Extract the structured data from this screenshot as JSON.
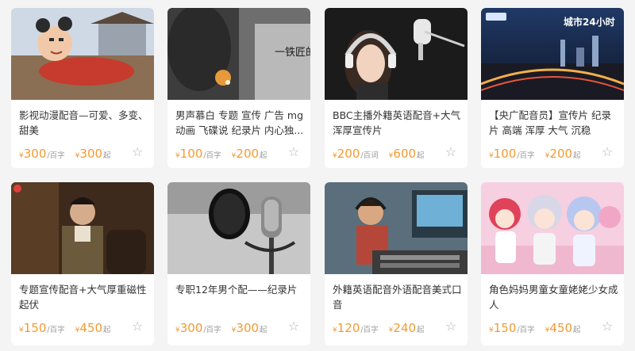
{
  "currency": "¥",
  "cards": [
    {
      "title": "影视动漫配音—可爱、多变、甜美",
      "price": "300",
      "unit": "/百字",
      "price2": "300",
      "suffix": "起",
      "thumb_label": ""
    },
    {
      "title": "男声慕白 专题 宣传 广告 mg动画 飞碟说 纪录片 内心独...",
      "price": "100",
      "unit": "/百字",
      "price2": "200",
      "suffix": "起",
      "thumb_label": "一铁匠的初"
    },
    {
      "title": "BBC主播外籍英语配音+大气浑厚宣传片",
      "price": "200",
      "unit": "/百词",
      "price2": "600",
      "suffix": "起",
      "thumb_label": ""
    },
    {
      "title": "【央广配音员】宣传片 纪录片 高端 浑厚 大气 沉稳",
      "price": "100",
      "unit": "/百字",
      "price2": "200",
      "suffix": "起",
      "thumb_label": "城市24小时"
    },
    {
      "title": "专题宣传配音+大气厚重磁性起伏",
      "price": "150",
      "unit": "/百字",
      "price2": "450",
      "suffix": "起",
      "thumb_label": ""
    },
    {
      "title": "专职12年男个配——纪录片",
      "price": "300",
      "unit": "/百字",
      "price2": "300",
      "suffix": "起",
      "thumb_label": ""
    },
    {
      "title": "外籍英语配音外语配音美式口音",
      "price": "120",
      "unit": "/百字",
      "price2": "240",
      "suffix": "起",
      "thumb_label": ""
    },
    {
      "title": "角色妈妈男童女童姥姥少女成人",
      "price": "150",
      "unit": "/百字",
      "price2": "450",
      "suffix": "起",
      "thumb_label": ""
    }
  ]
}
